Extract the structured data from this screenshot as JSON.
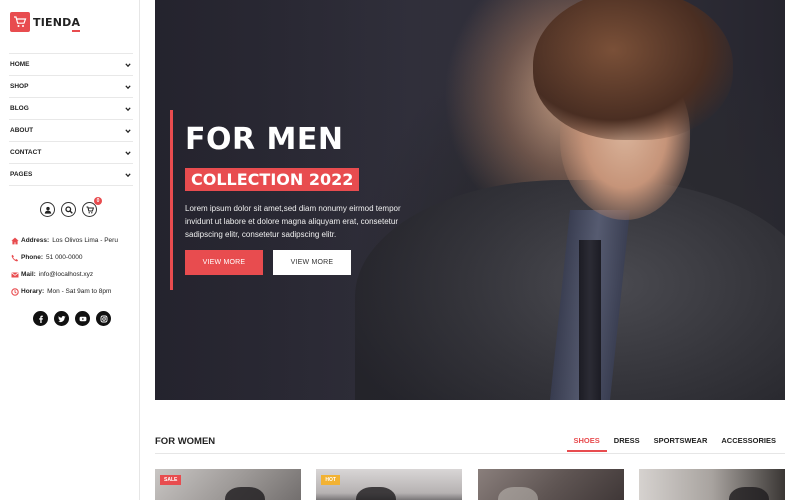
{
  "brand": {
    "name": "TIENDA",
    "accent_color": "#e84c4f",
    "logo_icon": "shopping-cart-icon"
  },
  "menu": [
    {
      "label": "HOME"
    },
    {
      "label": "SHOP"
    },
    {
      "label": "BLOG"
    },
    {
      "label": "ABOUT"
    },
    {
      "label": "CONTACT"
    },
    {
      "label": "PAGES"
    }
  ],
  "header_icons": {
    "user": "user-icon",
    "search": "search-icon",
    "cart": "cart-icon",
    "cart_count": "0"
  },
  "contact": {
    "address_label": "Address:",
    "address_value": "Los Olivos Lima - Peru",
    "phone_label": "Phone:",
    "phone_value": "51 000-0000",
    "mail_label": "Mail:",
    "mail_value": "info@localhost.xyz",
    "horary_label": "Horary:",
    "horary_value": "Mon - Sat 9am to 8pm"
  },
  "socials": [
    "facebook-icon",
    "twitter-icon",
    "youtube-icon",
    "instagram-icon"
  ],
  "hero": {
    "title": "FOR MEN",
    "subtitle": "COLLECTION 2022",
    "text": "Lorem ipsum dolor sit amet,sed diam nonumy eirmod tempor invidunt ut labore et dolore magna aliquyam erat, consetetur sadipscing elitr, consetetur sadipscing elitr.",
    "primary_button": "VIEW MORE",
    "secondary_button": "VIEW MORE"
  },
  "products_section": {
    "title": "FOR WOMEN",
    "tabs": [
      {
        "label": "SHOES",
        "active": true
      },
      {
        "label": "DRESS",
        "active": false
      },
      {
        "label": "SPORTSWEAR",
        "active": false
      },
      {
        "label": "ACCESSORIES",
        "active": false
      }
    ],
    "cards": [
      {
        "badge": "SALE"
      },
      {
        "badge": "HOT"
      },
      {
        "badge": ""
      },
      {
        "badge": ""
      }
    ]
  }
}
